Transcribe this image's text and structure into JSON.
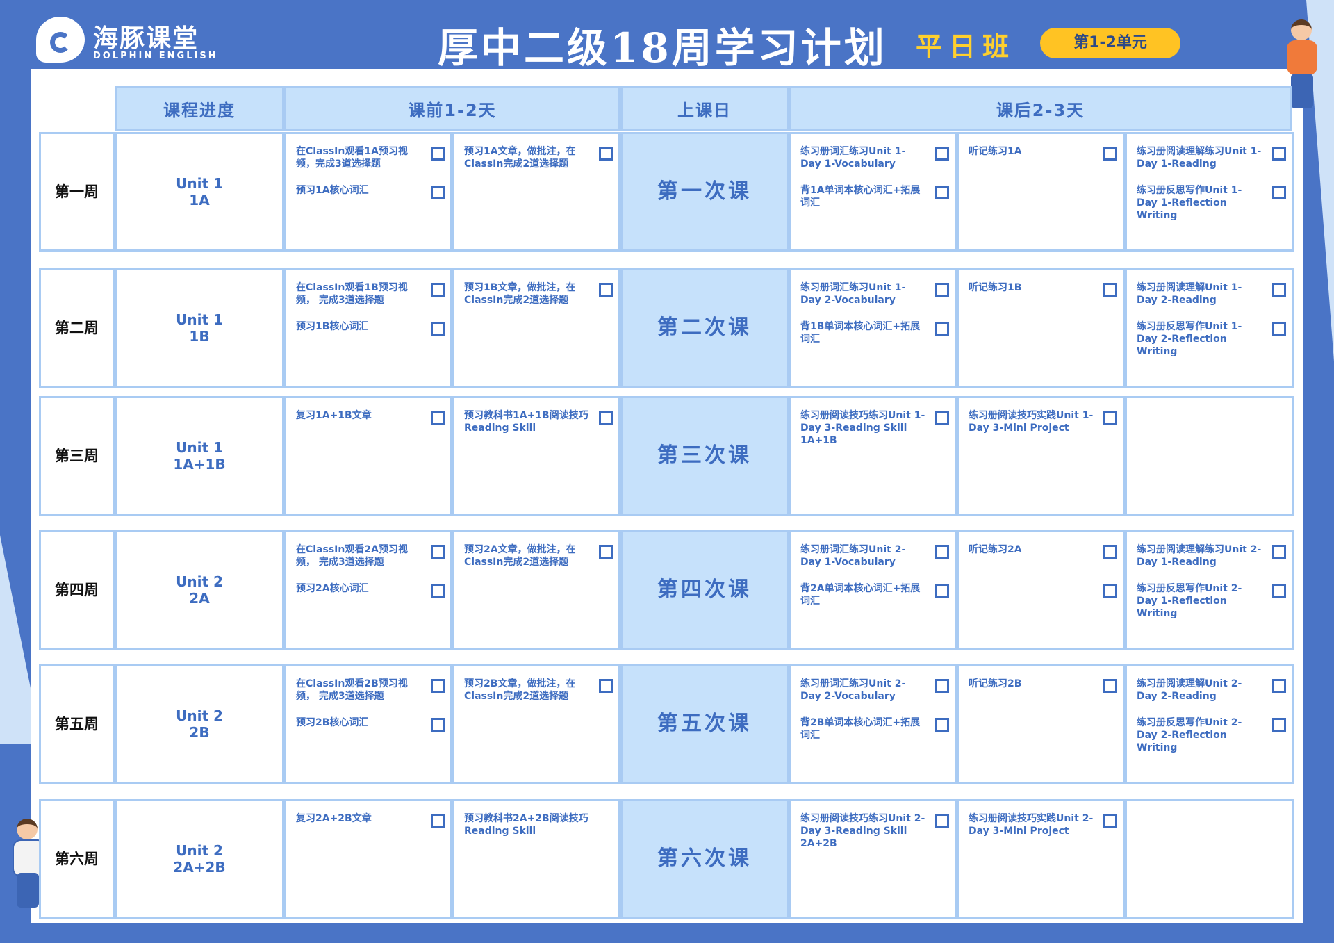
{
  "header": {
    "logo_cn": "海豚课堂",
    "logo_en": "DOLPHIN ENGLISH",
    "title": "厚中二级18周学习计划",
    "subtitle": "平日班",
    "badge": "第1-2单元"
  },
  "columns": {
    "progress": "课程进度",
    "before": "课前1-2天",
    "class_day": "上课日",
    "after": "课后2-3天"
  },
  "weeks": [
    {
      "label": "第一周",
      "unit": "Unit 1",
      "sub": "1A",
      "class": "第一次课",
      "pre1": [
        {
          "text": "在ClassIn观看1A预习视频，完成3道选择题",
          "check": true
        },
        {
          "text": "预习1A核心词汇",
          "check": true
        }
      ],
      "pre2": [
        {
          "text": "预习1A文章，做批注，在ClassIn完成2道选择题",
          "check": true
        }
      ],
      "post1": [
        {
          "text": "练习册词汇练习Unit 1-Day 1-Vocabulary",
          "check": true
        },
        {
          "text": "背1A单词本核心词汇+拓展词汇",
          "check": true
        }
      ],
      "post2": [
        {
          "text": "听记练习1A",
          "check": true
        }
      ],
      "post3": [
        {
          "text": "练习册阅读理解练习Unit 1-Day 1-Reading",
          "check": true
        },
        {
          "text": "练习册反思写作Unit 1-Day 1-Reflection Writing",
          "check": true
        }
      ]
    },
    {
      "label": "第二周",
      "unit": "Unit 1",
      "sub": "1B",
      "class": "第二次课",
      "pre1": [
        {
          "text": "在ClassIn观看1B预习视频， 完成3道选择题",
          "check": true
        },
        {
          "text": "预习1B核心词汇",
          "check": true
        }
      ],
      "pre2": [
        {
          "text": "预习1B文章，做批注，在ClassIn完成2道选择题",
          "check": true
        }
      ],
      "post1": [
        {
          "text": "练习册词汇练习Unit 1-Day 2-Vocabulary",
          "check": true
        },
        {
          "text": "背1B单词本核心词汇+拓展词汇",
          "check": true
        }
      ],
      "post2": [
        {
          "text": "听记练习1B",
          "check": true
        }
      ],
      "post3": [
        {
          "text": "练习册阅读理解Unit 1-Day 2-Reading",
          "check": true
        },
        {
          "text": "练习册反思写作Unit 1-Day 2-Reflection Writing",
          "check": true
        }
      ]
    },
    {
      "label": "第三周",
      "unit": "Unit 1",
      "sub": "1A+1B",
      "class": "第三次课",
      "pre1": [
        {
          "text": "复习1A+1B文章",
          "check": true
        }
      ],
      "pre2": [
        {
          "text": "预习教科书1A+1B阅读技巧Reading Skill",
          "check": true
        }
      ],
      "post1": [
        {
          "text": "练习册阅读技巧练习Unit 1-Day 3-Reading Skill 1A+1B",
          "check": true
        }
      ],
      "post2": [
        {
          "text": "练习册阅读技巧实践Unit 1-Day 3-Mini Project",
          "check": true
        }
      ],
      "post3": []
    },
    {
      "label": "第四周",
      "unit": "Unit 2",
      "sub": "2A",
      "class": "第四次课",
      "pre1": [
        {
          "text": "在ClassIn观看2A预习视频， 完成3道选择题",
          "check": true
        },
        {
          "text": "预习2A核心词汇",
          "check": true
        }
      ],
      "pre2": [
        {
          "text": "预习2A文章，做批注，在ClassIn完成2道选择题",
          "check": true
        }
      ],
      "post1": [
        {
          "text": "练习册词汇练习Unit 2-Day 1-Vocabulary",
          "check": true
        },
        {
          "text": "背2A单词本核心词汇+拓展词汇",
          "check": true
        }
      ],
      "post2": [
        {
          "text": "听记练习2A",
          "check": true
        },
        {
          "text": "",
          "check": true
        }
      ],
      "post3": [
        {
          "text": "练习册阅读理解练习Unit 2-Day 1-Reading",
          "check": true
        },
        {
          "text": "练习册反思写作Unit 2-Day 1-Reflection Writing",
          "check": true
        }
      ]
    },
    {
      "label": "第五周",
      "unit": "Unit 2",
      "sub": "2B",
      "class": "第五次课",
      "pre1": [
        {
          "text": "在ClassIn观看2B预习视频， 完成3道选择题",
          "check": true
        },
        {
          "text": "预习2B核心词汇",
          "check": true
        }
      ],
      "pre2": [
        {
          "text": "预习2B文章，做批注，在ClassIn完成2道选择题",
          "check": true
        }
      ],
      "post1": [
        {
          "text": "练习册词汇练习Unit 2-Day 2-Vocabulary",
          "check": true
        },
        {
          "text": "背2B单词本核心词汇+拓展词汇",
          "check": true
        }
      ],
      "post2": [
        {
          "text": "听记练习2B",
          "check": true
        }
      ],
      "post3": [
        {
          "text": "练习册阅读理解Unit 2-Day 2-Reading",
          "check": true
        },
        {
          "text": "练习册反思写作Unit 2-Day 2-Reflection Writing",
          "check": true
        }
      ]
    },
    {
      "label": "第六周",
      "unit": "Unit 2",
      "sub": "2A+2B",
      "class": "第六次课",
      "pre1": [
        {
          "text": "复习2A+2B文章",
          "check": true
        }
      ],
      "pre2": [
        {
          "text": "预习教科书2A+2B阅读技巧Reading Skill",
          "check": false
        }
      ],
      "post1": [
        {
          "text": "练习册阅读技巧练习Unit 2-Day 3-Reading Skill 2A+2B",
          "check": true
        }
      ],
      "post2": [
        {
          "text": "练习册阅读技巧实践Unit 2-Day 3-Mini Project",
          "check": true
        }
      ],
      "post3": []
    }
  ]
}
